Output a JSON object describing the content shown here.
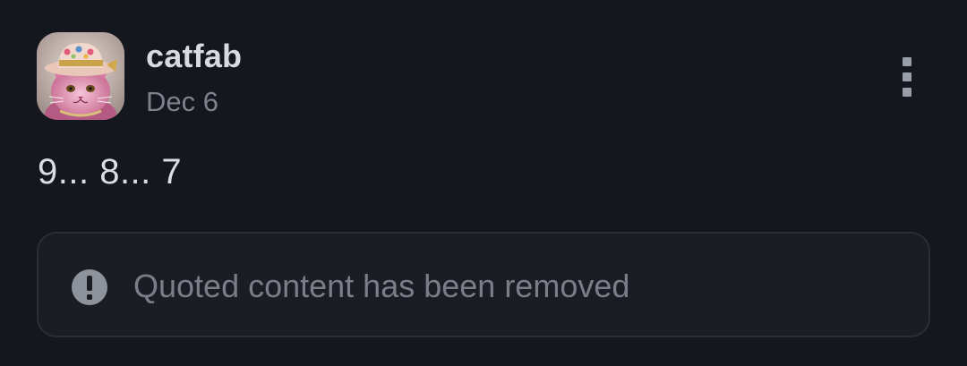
{
  "post": {
    "author": "catfab",
    "date": "Dec 6",
    "body": "9... 8... 7",
    "more_icon": "more-vertical-icon"
  },
  "quote": {
    "icon": "exclamation-circle-icon",
    "text": "Quoted content has been removed"
  },
  "colors": {
    "background": "#15171e",
    "quote_background": "#1b1d24",
    "quote_border": "#2b2e37",
    "author": "#d9dadf",
    "secondary_text": "#7e828c"
  }
}
